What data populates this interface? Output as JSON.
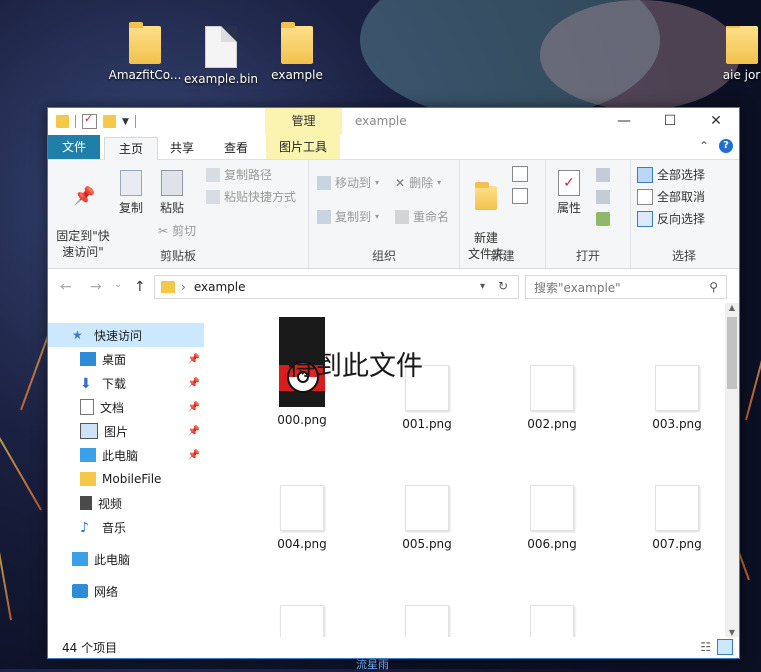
{
  "desktop": {
    "icons": [
      {
        "label": "AmazfitCo...",
        "kind": "folder"
      },
      {
        "label": "example.bin",
        "kind": "file"
      },
      {
        "label": "example",
        "kind": "folder"
      },
      {
        "label": "aie jor",
        "kind": "folder"
      }
    ],
    "footer_text": "流星雨"
  },
  "window": {
    "title": "example",
    "context_tab": "管理",
    "quick_access_toolbar": [
      "folder-icon",
      "properties-icon",
      "new-folder-icon",
      "dropdown-icon"
    ],
    "controls": {
      "minimize": "—",
      "maximize": "☐",
      "close": "✕"
    }
  },
  "ribbon": {
    "tabs": {
      "file": "文件",
      "home": "主页",
      "share": "共享",
      "view": "查看",
      "picture_tools": "图片工具"
    },
    "clipboard": {
      "label": "剪贴板",
      "pin": "固定到\"快\n速访问\"",
      "copy": "复制",
      "paste": "粘贴",
      "copy_path": "复制路径",
      "paste_shortcut": "粘贴快捷方式",
      "cut": "剪切"
    },
    "organize": {
      "label": "组织",
      "move_to": "移动到",
      "copy_to": "复制到",
      "delete": "删除",
      "rename": "重命名"
    },
    "new": {
      "label": "新建",
      "new_folder": "新建\n文件夹"
    },
    "open": {
      "label": "打开",
      "properties": "属性"
    },
    "select": {
      "label": "选择",
      "select_all": "全部选择",
      "select_none": "全部取消",
      "invert": "反向选择"
    }
  },
  "address": {
    "path": "example",
    "search_placeholder": "搜索\"example\""
  },
  "nav": {
    "items": [
      {
        "label": "快速访问",
        "icon": "star-icon",
        "active": true,
        "pinned": false
      },
      {
        "label": "桌面",
        "icon": "desktop-icon",
        "pinned": true
      },
      {
        "label": "下载",
        "icon": "download-icon",
        "pinned": true
      },
      {
        "label": "文档",
        "icon": "document-icon",
        "pinned": true
      },
      {
        "label": "图片",
        "icon": "picture-icon",
        "pinned": true
      },
      {
        "label": "此电脑",
        "icon": "computer-icon",
        "pinned": true
      },
      {
        "label": "MobileFile",
        "icon": "folder-icon",
        "pinned": false
      },
      {
        "label": "视频",
        "icon": "video-icon",
        "pinned": false
      },
      {
        "label": "音乐",
        "icon": "music-icon",
        "pinned": false
      },
      {
        "label": "此电脑",
        "icon": "computer-icon",
        "pinned": false
      },
      {
        "label": "网络",
        "icon": "network-icon",
        "pinned": false
      }
    ]
  },
  "files": [
    {
      "name": "000.png"
    },
    {
      "name": "001.png"
    },
    {
      "name": "002.png"
    },
    {
      "name": "003.png"
    },
    {
      "name": "004.png"
    },
    {
      "name": "005.png"
    },
    {
      "name": "006.png"
    },
    {
      "name": "007.png"
    }
  ],
  "overlay_text": "得到此文件",
  "status": {
    "count": "44 个项目"
  }
}
